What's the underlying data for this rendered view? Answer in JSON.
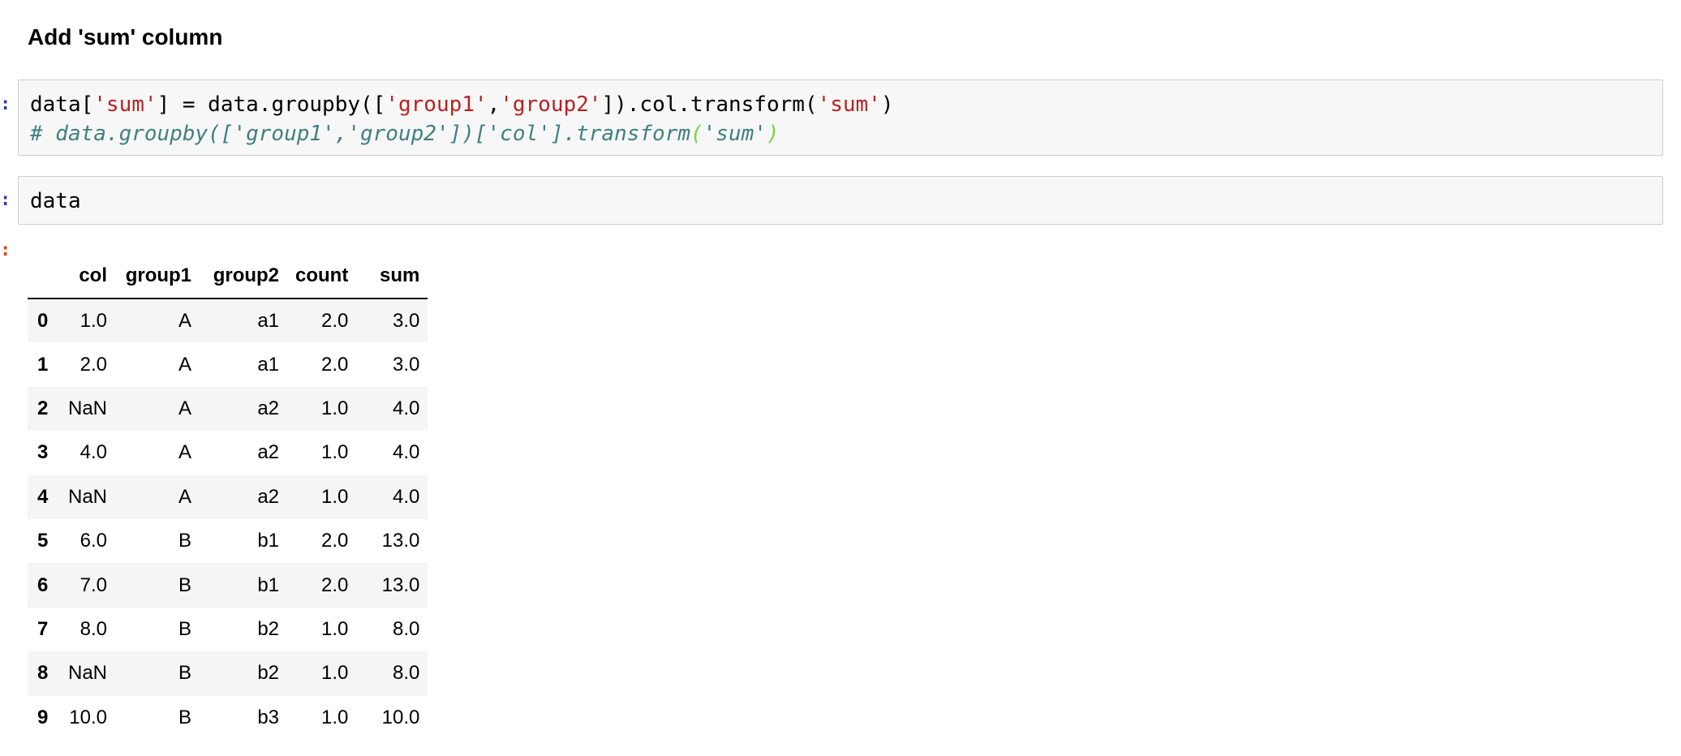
{
  "heading": "Add 'sum' column",
  "prompts": {
    "in": ":",
    "out": ":"
  },
  "cell1": {
    "line1": {
      "p1": "data[",
      "s1": "'sum'",
      "p2": "] = data.groupby([",
      "s2": "'group1'",
      "p3": ",",
      "s3": "'group2'",
      "p4": "]).col.transform(",
      "s4": "'sum'",
      "p5": ")"
    },
    "line2": {
      "comment": "# data.groupby(['group1','group2'])['col'].transform",
      "paren_open": "(",
      "arg": "'sum'",
      "paren_close": ")"
    }
  },
  "cell2": {
    "code": "data"
  },
  "table": {
    "columns": [
      "",
      "col",
      "group1",
      "group2",
      "count",
      "sum"
    ],
    "rows": [
      [
        "0",
        "1.0",
        "A",
        "a1",
        "2.0",
        "3.0"
      ],
      [
        "1",
        "2.0",
        "A",
        "a1",
        "2.0",
        "3.0"
      ],
      [
        "2",
        "NaN",
        "A",
        "a2",
        "1.0",
        "4.0"
      ],
      [
        "3",
        "4.0",
        "A",
        "a2",
        "1.0",
        "4.0"
      ],
      [
        "4",
        "NaN",
        "A",
        "a2",
        "1.0",
        "4.0"
      ],
      [
        "5",
        "6.0",
        "B",
        "b1",
        "2.0",
        "13.0"
      ],
      [
        "6",
        "7.0",
        "B",
        "b1",
        "2.0",
        "13.0"
      ],
      [
        "7",
        "8.0",
        "B",
        "b2",
        "1.0",
        "8.0"
      ],
      [
        "8",
        "NaN",
        "B",
        "b2",
        "1.0",
        "8.0"
      ],
      [
        "9",
        "10.0",
        "B",
        "b3",
        "1.0",
        "10.0"
      ]
    ]
  }
}
